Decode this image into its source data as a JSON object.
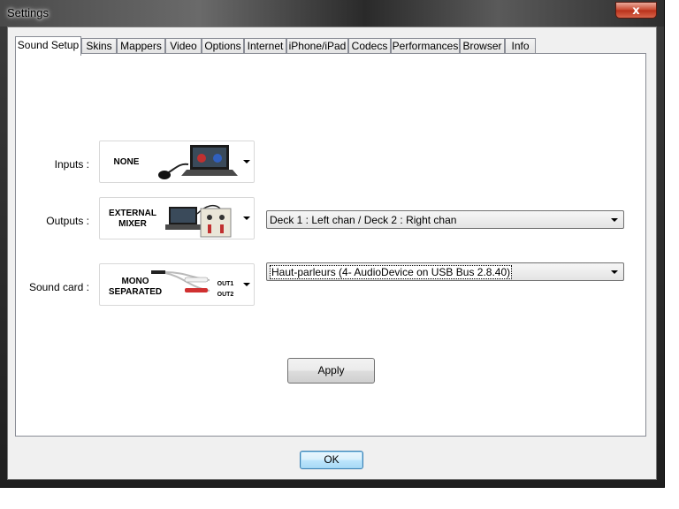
{
  "window": {
    "title": "Settings",
    "close_label": "x"
  },
  "tabs": [
    {
      "label": "Sound Setup",
      "active": true
    },
    {
      "label": "Skins"
    },
    {
      "label": "Mappers"
    },
    {
      "label": "Video"
    },
    {
      "label": "Options"
    },
    {
      "label": "Internet"
    },
    {
      "label": "iPhone/iPad"
    },
    {
      "label": "Codecs"
    },
    {
      "label": "Performances"
    },
    {
      "label": "Browser"
    },
    {
      "label": "Info"
    }
  ],
  "sound_setup": {
    "inputs": {
      "label": "Inputs :",
      "value_line1": "NONE"
    },
    "outputs": {
      "label": "Outputs :",
      "value_line1": "EXTERNAL",
      "value_line2": "MIXER",
      "routing": "Deck 1 : Left chan / Deck 2 : Right chan"
    },
    "soundcard": {
      "label": "Sound card :",
      "value_line1": "MONO",
      "value_line2": "SEPARATED",
      "out1": "OUT1",
      "out2": "OUT2",
      "device": "Haut-parleurs (4- AudioDevice on USB Bus 2.8.40)"
    },
    "apply_label": "Apply"
  },
  "ok_label": "OK",
  "colors": {
    "close_red": "#c7452c",
    "default_button_border": "#3c7fb1"
  }
}
